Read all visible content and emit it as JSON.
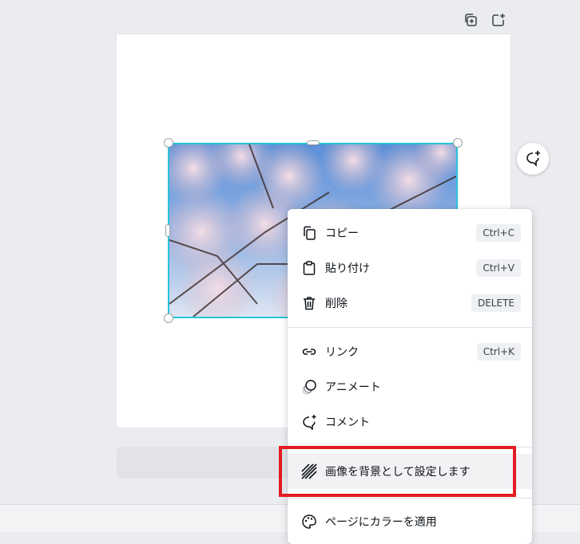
{
  "toolbar": {
    "icons": [
      "duplicate-page-icon",
      "add-page-icon"
    ]
  },
  "canvas": {
    "image_alt": "cherry blossom photo"
  },
  "context_menu": {
    "items": [
      {
        "label": "コピー",
        "shortcut": "Ctrl+C",
        "icon": "copy-icon"
      },
      {
        "label": "貼り付け",
        "shortcut": "Ctrl+V",
        "icon": "clipboard-icon"
      },
      {
        "label": "削除",
        "shortcut": "DELETE",
        "icon": "trash-icon"
      },
      {
        "label": "リンク",
        "shortcut": "Ctrl+K",
        "icon": "link-icon"
      },
      {
        "label": "アニメート",
        "icon": "animate-icon"
      },
      {
        "label": "コメント",
        "icon": "comment-icon"
      },
      {
        "label": "画像を背景として設定します",
        "icon": "set-background-icon"
      },
      {
        "label": "ページにカラーを適用",
        "icon": "palette-icon"
      }
    ]
  },
  "colors": {
    "selection": "#27c4d8",
    "highlight_box": "#e31b23"
  }
}
